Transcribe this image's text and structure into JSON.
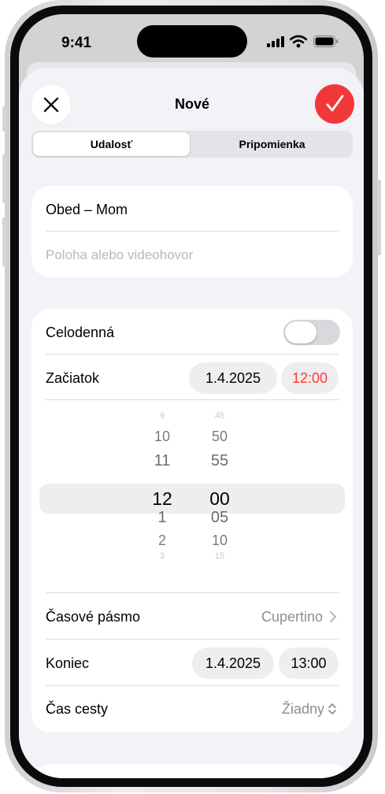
{
  "status_bar": {
    "time": "9:41"
  },
  "header": {
    "title": "Nové",
    "close_icon": "close-icon",
    "confirm_icon": "checkmark-icon"
  },
  "segments": [
    {
      "label": "Udalosť",
      "selected": true
    },
    {
      "label": "Pripomienka",
      "selected": false
    }
  ],
  "event": {
    "title_value": "Obed – Mom",
    "location_placeholder": "Poloha alebo videohovor"
  },
  "details": {
    "all_day_label": "Celodenná",
    "all_day_on": false,
    "start_label": "Začiatok",
    "start_date": "1.4.2025",
    "start_time": "12:00",
    "picker_hours": [
      "9",
      "10",
      "11",
      "12",
      "1",
      "2",
      "3"
    ],
    "picker_minutes": [
      "45",
      "50",
      "55",
      "00",
      "05",
      "10",
      "15"
    ],
    "timezone_label": "Časové pásmo",
    "timezone_value": "Cupertino",
    "end_label": "Koniec",
    "end_date": "1.4.2025",
    "end_time": "13:00",
    "travel_label": "Čas cesty",
    "travel_value": "Žiadny"
  },
  "colors": {
    "accent_red": "#f2373a",
    "time_red": "#ff3b30",
    "sheet_bg": "#f2f2f7"
  }
}
